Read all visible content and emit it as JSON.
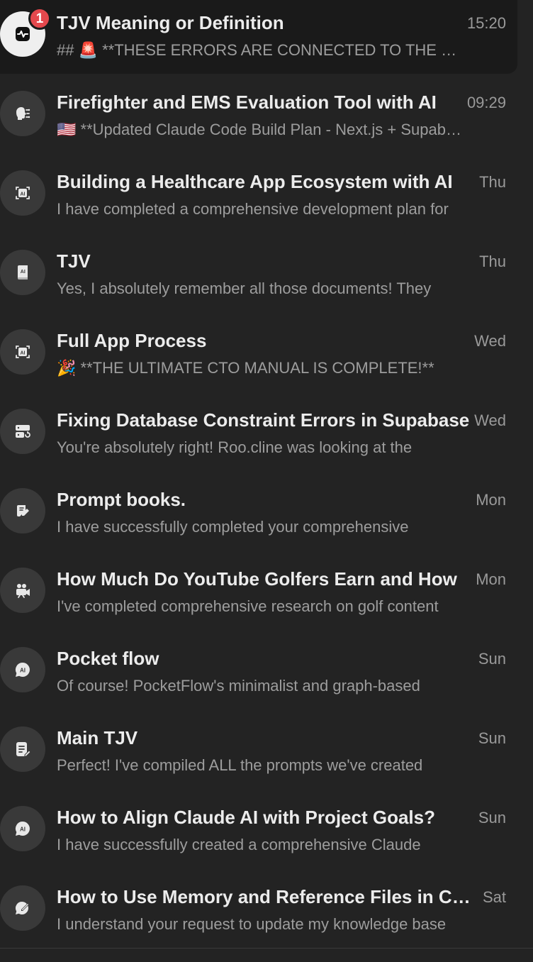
{
  "chats": [
    {
      "title": "TJV Meaning or Definition",
      "time": "15:20",
      "preview": "## 🚨 **THESE ERRORS ARE CONNECTED TO THE SCREEN",
      "icon": "activity-icon",
      "badge": "1",
      "active": true
    },
    {
      "title": "Firefighter and EMS Evaluation Tool with AI",
      "time": "09:29",
      "preview": "🇺🇸 **Updated Claude Code Build Plan - Next.js + Supabase",
      "icon": "head-circuit-icon",
      "badge": "",
      "active": false
    },
    {
      "title": "Building a Healthcare App Ecosystem with AI",
      "time": "Thu",
      "preview": "I have completed a comprehensive development plan for",
      "icon": "ai-scan-icon",
      "badge": "",
      "active": false
    },
    {
      "title": "TJV",
      "time": "Thu",
      "preview": "Yes, I absolutely remember all those documents! They",
      "icon": "ai-book-icon",
      "badge": "",
      "active": false
    },
    {
      "title": "Full App Process",
      "time": "Wed",
      "preview": "🎉 **THE ULTIMATE CTO MANUAL IS COMPLETE!**",
      "icon": "ai-scan-icon",
      "badge": "",
      "active": false
    },
    {
      "title": "Fixing Database Constraint Errors in Supabase",
      "time": "Wed",
      "preview": "You're absolutely right! Roo.cline was looking at the",
      "icon": "server-refresh-icon",
      "badge": "",
      "active": false
    },
    {
      "title": "Prompt books.",
      "time": "Mon",
      "preview": "I have successfully completed your comprehensive",
      "icon": "note-edit-icon",
      "badge": "",
      "active": false
    },
    {
      "title": "How Much Do YouTube Golfers Earn and How",
      "time": "Mon",
      "preview": "I've completed comprehensive research on golf content",
      "icon": "video-camera-icon",
      "badge": "",
      "active": false
    },
    {
      "title": "Pocket flow",
      "time": "Sun",
      "preview": "Of course! PocketFlow's minimalist and graph-based",
      "icon": "ai-chat-icon",
      "badge": "",
      "active": false
    },
    {
      "title": "Main TJV",
      "time": "Sun",
      "preview": "Perfect! I've compiled ALL the prompts we've created",
      "icon": "document-edit-icon",
      "badge": "",
      "active": false
    },
    {
      "title": "How to Align Claude AI with Project Goals?",
      "time": "Sun",
      "preview": "I have successfully created a comprehensive Claude",
      "icon": "ai-chat-icon",
      "badge": "",
      "active": false
    },
    {
      "title": "How to Use Memory and Reference Files in Claude",
      "time": "Sat",
      "preview": "I understand your request to update my knowledge base",
      "icon": "chat-edit-icon",
      "badge": "",
      "active": false
    }
  ]
}
